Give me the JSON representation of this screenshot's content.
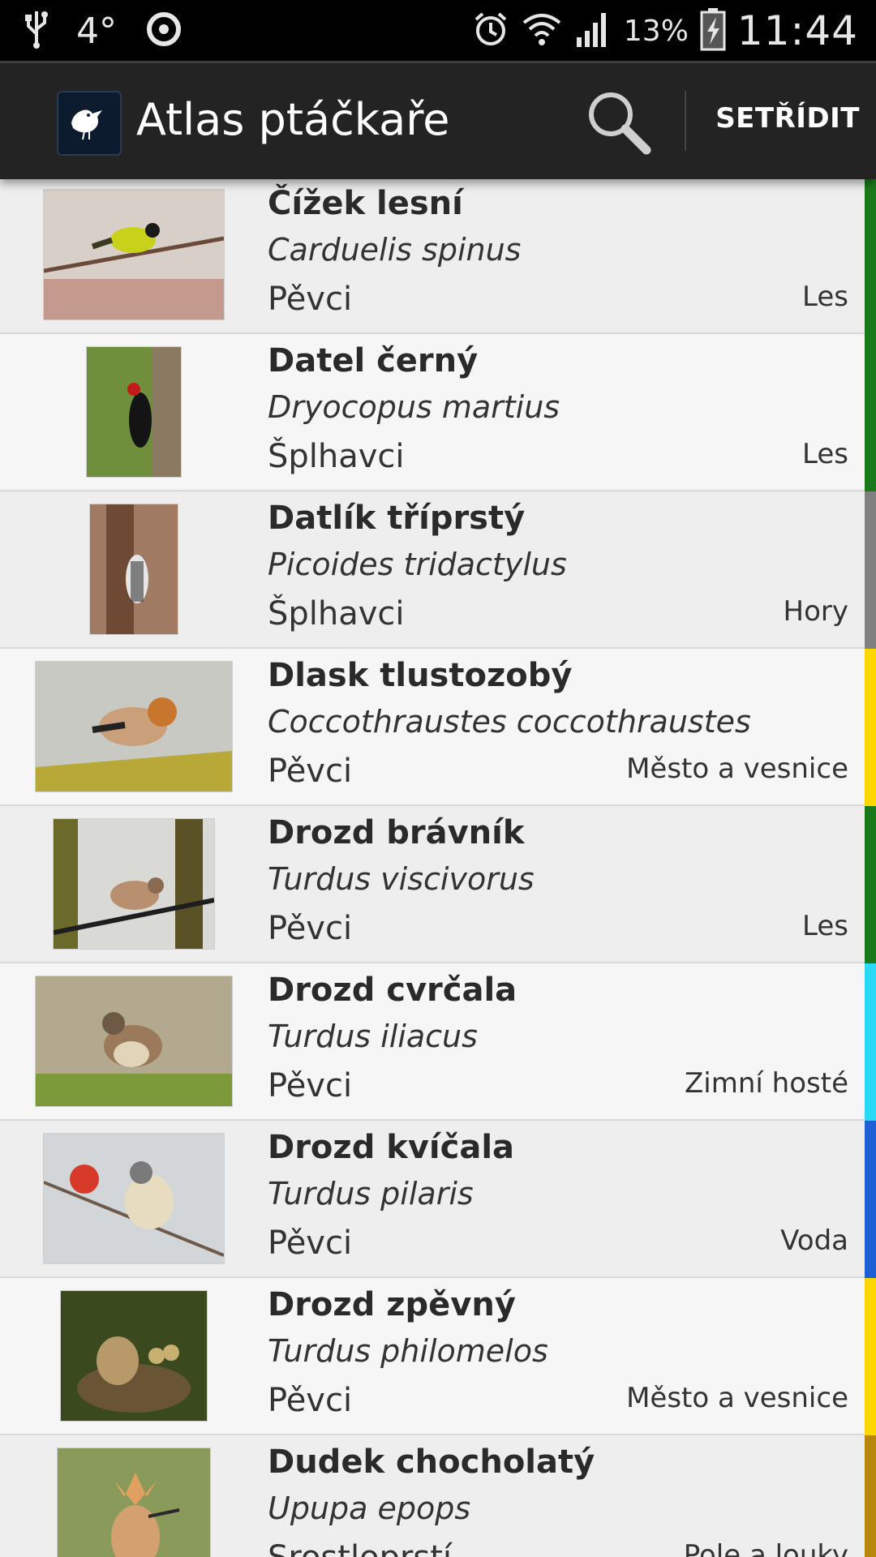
{
  "status_bar": {
    "temperature": "4°",
    "battery": "13%",
    "time": "11:44"
  },
  "app_bar": {
    "title": "Atlas ptáčkaře",
    "sort_label": "SETŘÍDIT"
  },
  "birds": [
    {
      "name": "Čížek lesní",
      "latin": "Carduelis spinus",
      "order": "Pěvci",
      "habitat": "Les",
      "color": "#1a7a1a"
    },
    {
      "name": "Datel černý",
      "latin": "Dryocopus martius",
      "order": "Šplhavci",
      "habitat": "Les",
      "color": "#1a7a1a"
    },
    {
      "name": "Datlík tříprstý",
      "latin": "Picoides tridactylus",
      "order": "Šplhavci",
      "habitat": "Hory",
      "color": "#808080"
    },
    {
      "name": "Dlask tlustozobý",
      "latin": "Coccothraustes coccothraustes",
      "order": "Pěvci",
      "habitat": "Město a vesnice",
      "color": "#ffd700"
    },
    {
      "name": "Drozd brávník",
      "latin": "Turdus viscivorus",
      "order": "Pěvci",
      "habitat": "Les",
      "color": "#1a7a1a"
    },
    {
      "name": "Drozd cvrčala",
      "latin": "Turdus iliacus",
      "order": "Pěvci",
      "habitat": "Zimní hosté",
      "color": "#29d9f5"
    },
    {
      "name": "Drozd kvíčala",
      "latin": "Turdus pilaris",
      "order": "Pěvci",
      "habitat": "Voda",
      "color": "#1f5fd6"
    },
    {
      "name": "Drozd zpěvný",
      "latin": "Turdus philomelos",
      "order": "Pěvci",
      "habitat": "Město a vesnice",
      "color": "#ffd700"
    },
    {
      "name": "Dudek chocholatý",
      "latin": "Upupa epops",
      "order": "Srostloprstí",
      "habitat": "Pole a louky",
      "color": "#b8860b"
    }
  ]
}
